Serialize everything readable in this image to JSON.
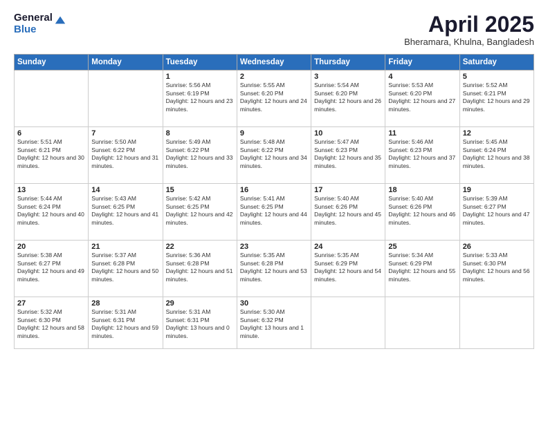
{
  "logo": {
    "general": "General",
    "blue": "Blue"
  },
  "header": {
    "title": "April 2025",
    "subtitle": "Bheramara, Khulna, Bangladesh"
  },
  "weekdays": [
    "Sunday",
    "Monday",
    "Tuesday",
    "Wednesday",
    "Thursday",
    "Friday",
    "Saturday"
  ],
  "weeks": [
    [
      {
        "day": "",
        "info": ""
      },
      {
        "day": "",
        "info": ""
      },
      {
        "day": "1",
        "info": "Sunrise: 5:56 AM\nSunset: 6:19 PM\nDaylight: 12 hours and 23 minutes."
      },
      {
        "day": "2",
        "info": "Sunrise: 5:55 AM\nSunset: 6:20 PM\nDaylight: 12 hours and 24 minutes."
      },
      {
        "day": "3",
        "info": "Sunrise: 5:54 AM\nSunset: 6:20 PM\nDaylight: 12 hours and 26 minutes."
      },
      {
        "day": "4",
        "info": "Sunrise: 5:53 AM\nSunset: 6:20 PM\nDaylight: 12 hours and 27 minutes."
      },
      {
        "day": "5",
        "info": "Sunrise: 5:52 AM\nSunset: 6:21 PM\nDaylight: 12 hours and 29 minutes."
      }
    ],
    [
      {
        "day": "6",
        "info": "Sunrise: 5:51 AM\nSunset: 6:21 PM\nDaylight: 12 hours and 30 minutes."
      },
      {
        "day": "7",
        "info": "Sunrise: 5:50 AM\nSunset: 6:22 PM\nDaylight: 12 hours and 31 minutes."
      },
      {
        "day": "8",
        "info": "Sunrise: 5:49 AM\nSunset: 6:22 PM\nDaylight: 12 hours and 33 minutes."
      },
      {
        "day": "9",
        "info": "Sunrise: 5:48 AM\nSunset: 6:22 PM\nDaylight: 12 hours and 34 minutes."
      },
      {
        "day": "10",
        "info": "Sunrise: 5:47 AM\nSunset: 6:23 PM\nDaylight: 12 hours and 35 minutes."
      },
      {
        "day": "11",
        "info": "Sunrise: 5:46 AM\nSunset: 6:23 PM\nDaylight: 12 hours and 37 minutes."
      },
      {
        "day": "12",
        "info": "Sunrise: 5:45 AM\nSunset: 6:24 PM\nDaylight: 12 hours and 38 minutes."
      }
    ],
    [
      {
        "day": "13",
        "info": "Sunrise: 5:44 AM\nSunset: 6:24 PM\nDaylight: 12 hours and 40 minutes."
      },
      {
        "day": "14",
        "info": "Sunrise: 5:43 AM\nSunset: 6:25 PM\nDaylight: 12 hours and 41 minutes."
      },
      {
        "day": "15",
        "info": "Sunrise: 5:42 AM\nSunset: 6:25 PM\nDaylight: 12 hours and 42 minutes."
      },
      {
        "day": "16",
        "info": "Sunrise: 5:41 AM\nSunset: 6:25 PM\nDaylight: 12 hours and 44 minutes."
      },
      {
        "day": "17",
        "info": "Sunrise: 5:40 AM\nSunset: 6:26 PM\nDaylight: 12 hours and 45 minutes."
      },
      {
        "day": "18",
        "info": "Sunrise: 5:40 AM\nSunset: 6:26 PM\nDaylight: 12 hours and 46 minutes."
      },
      {
        "day": "19",
        "info": "Sunrise: 5:39 AM\nSunset: 6:27 PM\nDaylight: 12 hours and 47 minutes."
      }
    ],
    [
      {
        "day": "20",
        "info": "Sunrise: 5:38 AM\nSunset: 6:27 PM\nDaylight: 12 hours and 49 minutes."
      },
      {
        "day": "21",
        "info": "Sunrise: 5:37 AM\nSunset: 6:28 PM\nDaylight: 12 hours and 50 minutes."
      },
      {
        "day": "22",
        "info": "Sunrise: 5:36 AM\nSunset: 6:28 PM\nDaylight: 12 hours and 51 minutes."
      },
      {
        "day": "23",
        "info": "Sunrise: 5:35 AM\nSunset: 6:28 PM\nDaylight: 12 hours and 53 minutes."
      },
      {
        "day": "24",
        "info": "Sunrise: 5:35 AM\nSunset: 6:29 PM\nDaylight: 12 hours and 54 minutes."
      },
      {
        "day": "25",
        "info": "Sunrise: 5:34 AM\nSunset: 6:29 PM\nDaylight: 12 hours and 55 minutes."
      },
      {
        "day": "26",
        "info": "Sunrise: 5:33 AM\nSunset: 6:30 PM\nDaylight: 12 hours and 56 minutes."
      }
    ],
    [
      {
        "day": "27",
        "info": "Sunrise: 5:32 AM\nSunset: 6:30 PM\nDaylight: 12 hours and 58 minutes."
      },
      {
        "day": "28",
        "info": "Sunrise: 5:31 AM\nSunset: 6:31 PM\nDaylight: 12 hours and 59 minutes."
      },
      {
        "day": "29",
        "info": "Sunrise: 5:31 AM\nSunset: 6:31 PM\nDaylight: 13 hours and 0 minutes."
      },
      {
        "day": "30",
        "info": "Sunrise: 5:30 AM\nSunset: 6:32 PM\nDaylight: 13 hours and 1 minute."
      },
      {
        "day": "",
        "info": ""
      },
      {
        "day": "",
        "info": ""
      },
      {
        "day": "",
        "info": ""
      }
    ]
  ]
}
